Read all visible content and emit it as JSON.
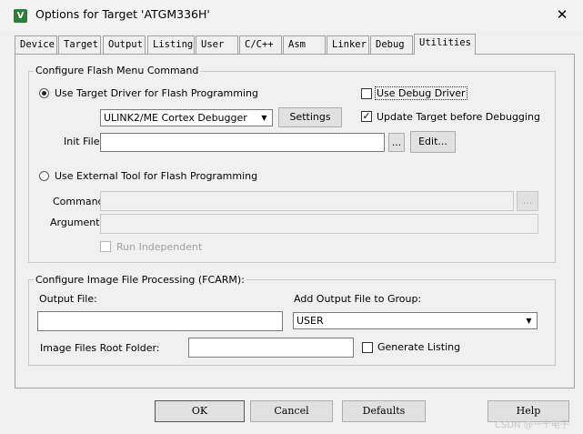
{
  "window": {
    "title": "Options for Target 'ATGM336H'",
    "app_icon": "keil-uvision-icon",
    "close_glyph": "✕"
  },
  "tabs": [
    {
      "label": "Device"
    },
    {
      "label": "Target"
    },
    {
      "label": "Output"
    },
    {
      "label": "Listing"
    },
    {
      "label": "User"
    },
    {
      "label": "C/C++"
    },
    {
      "label": "Asm"
    },
    {
      "label": "Linker"
    },
    {
      "label": "Debug"
    },
    {
      "label": "Utilities",
      "active": true
    }
  ],
  "flash_group": {
    "legend": "Configure Flash Menu Command",
    "use_target_driver_label": "Use Target Driver for Flash Programming",
    "use_target_driver_selected": true,
    "driver_value": "ULINK2/ME Cortex Debugger",
    "settings_label": "Settings",
    "use_debug_driver_label": "Use Debug Driver",
    "use_debug_driver_checked": false,
    "update_target_label": "Update Target before Debugging",
    "update_target_checked": true,
    "init_file_label": "Init File:",
    "init_file_value": "",
    "browse_label": "...",
    "edit_label": "Edit...",
    "use_external_tool_label": "Use External Tool for Flash Programming",
    "use_external_tool_selected": false,
    "command_label": "Command:",
    "command_value": "",
    "arguments_label": "Arguments:",
    "arguments_value": "",
    "run_independent_label": "Run Independent",
    "run_independent_checked": false
  },
  "image_group": {
    "legend": "Configure Image File Processing (FCARM):",
    "output_file_label": "Output File:",
    "output_file_value": "",
    "add_output_label": "Add Output File  to Group:",
    "group_value": "USER",
    "root_folder_label": "Image Files Root Folder:",
    "root_folder_value": "",
    "generate_listing_label": "Generate Listing",
    "generate_listing_checked": false
  },
  "footer": {
    "ok_label": "OK",
    "cancel_label": "Cancel",
    "defaults_label": "Defaults",
    "help_label": "Help"
  },
  "watermark": "CSDN @一十电子",
  "colors": {
    "window_bg": "#f0f0f0",
    "title_bg": "#f3f3f3",
    "disabled_text": "#a0a0a0"
  }
}
